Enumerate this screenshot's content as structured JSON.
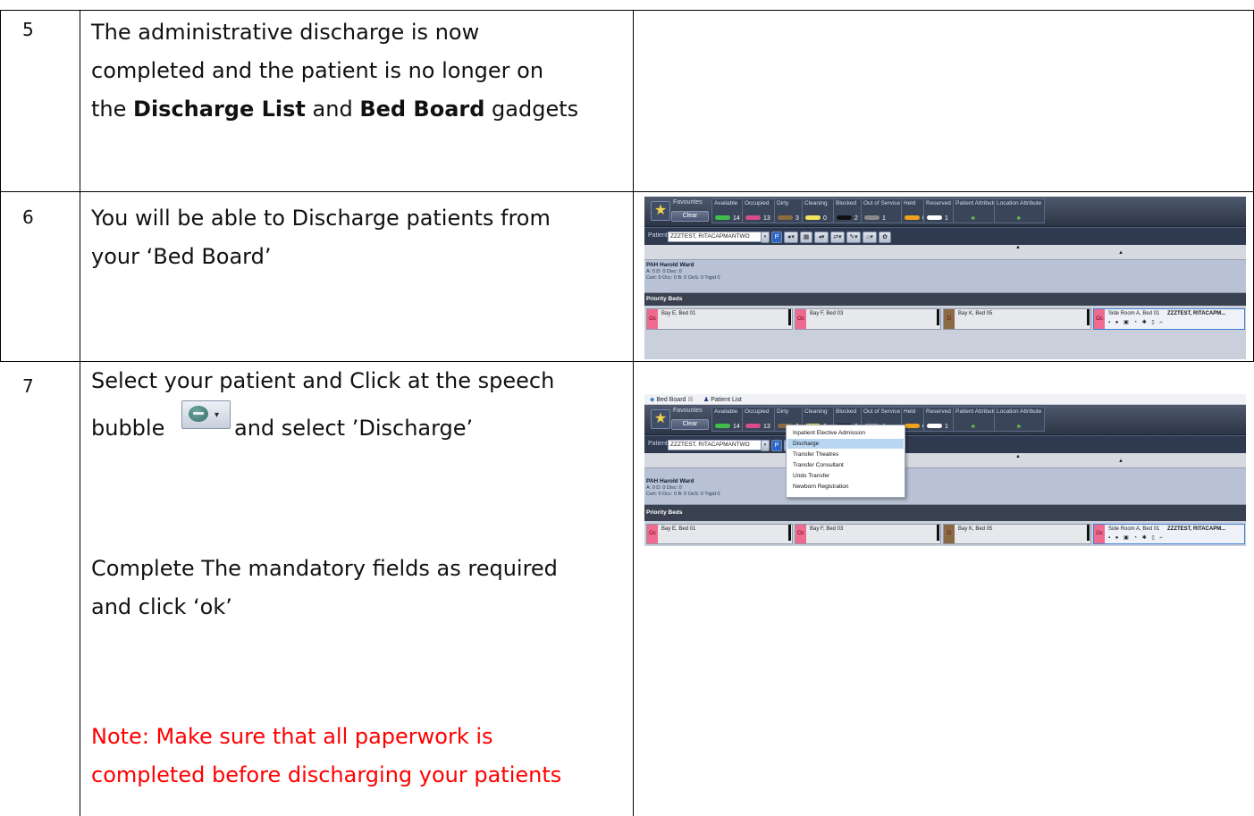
{
  "rows": [
    {
      "number": "5",
      "text_lines": [
        {
          "parts": [
            {
              "t": "The administrative discharge is now",
              "b": false
            }
          ]
        },
        {
          "parts": [
            {
              "t": "completed and the patient is no longer on",
              "b": false
            }
          ]
        },
        {
          "parts": [
            {
              "t": "the ",
              "b": false
            },
            {
              "t": "Discharge List",
              "b": true
            },
            {
              "t": " and ",
              "b": false
            },
            {
              "t": "Bed Board",
              "b": true
            },
            {
              "t": " gadgets",
              "b": false
            }
          ]
        }
      ]
    },
    {
      "number": "6",
      "line1": "You will be able to Discharge patients from",
      "line2": "your ‘Bed Board’"
    },
    {
      "number": "7",
      "line1": "Select your patient and Click at the speech",
      "line2_a": "bubble",
      "line2_b": "and select ’Discharge’",
      "line3": "Complete The mandatory fields as required",
      "line4": "and click ‘ok’",
      "note1": "Note: Make sure that all paperwork is",
      "note2": "completed before discharging your patients",
      "note_color": "#ff0000"
    }
  ],
  "bedboard": {
    "favourites": "Favourites",
    "clear": "Clear",
    "categories": [
      {
        "label": "Available",
        "count": "14",
        "color": "#3fbf4a"
      },
      {
        "label": "Occupied",
        "count": "13",
        "color": "#d64d8a"
      },
      {
        "label": "Dirty",
        "count": "3",
        "color": "#8c6b3f"
      },
      {
        "label": "Cleaning",
        "count": "0",
        "color": "#f2e35a"
      },
      {
        "label": "Blocked",
        "count": "2",
        "color": "#111111"
      },
      {
        "label": "Out of Service",
        "count": "1",
        "color": "#8a8a8a"
      },
      {
        "label": "Held",
        "count": "0",
        "color": "#f0a21c"
      },
      {
        "label": "Reserved",
        "count": "1",
        "color": "#ffffff"
      },
      {
        "label": "Patient Attribute",
        "count": "",
        "color": ""
      },
      {
        "label": "Location Attribute",
        "count": "",
        "color": ""
      }
    ],
    "patient_label": "Patient",
    "patient_value": "ZZZTEST, RITACAPMANTWO",
    "ward_name": "PAH Harold Ward",
    "ward_stats_1": "A: 0 D: 0 Disc: 0",
    "ward_stats_2": "Cert: 0 Occ: 0 B: 0 OoS: 0 Trgtd 0",
    "priority_beds": "Priority Beds",
    "beds": [
      {
        "oc": "Oc",
        "name": "Bay E, Bed 01"
      },
      {
        "oc": "Oc",
        "name": "Bay F, Bed 03"
      },
      {
        "oc": "D",
        "name": "Bay K, Bed 05"
      },
      {
        "oc": "Oc",
        "name": "Side Room A, Bed 01",
        "patient": "ZZZTEST, RITACAPM..."
      }
    ],
    "tabs": [
      "Bed Board",
      "Patient List"
    ],
    "menu_items": [
      "Inpatient Elective Admission",
      "Discharge",
      "Transfer Theatres",
      "Transfer Consultant",
      "Undo Transfer",
      "Newborn Registration"
    ],
    "menu_selected": "Discharge"
  }
}
